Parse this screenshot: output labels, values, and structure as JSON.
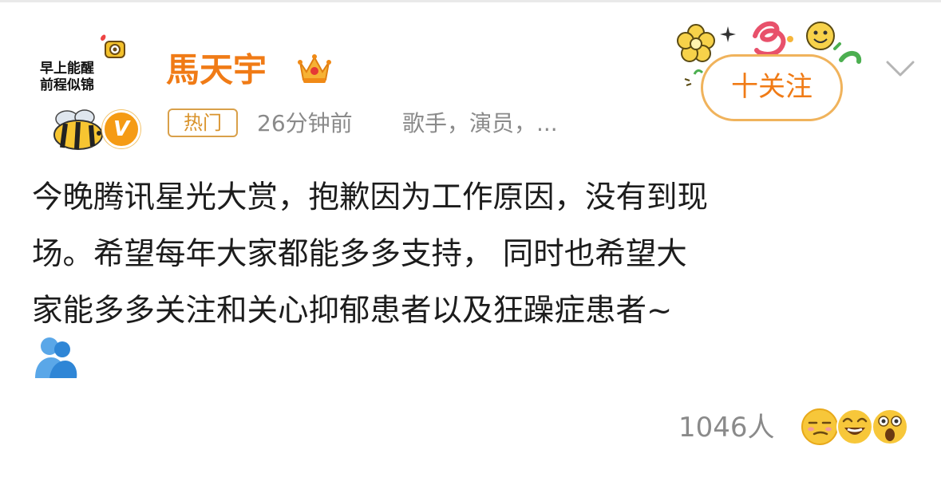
{
  "post": {
    "author": {
      "name": "馬天宇",
      "avatar_text": [
        "早上能醒",
        "前程似锦"
      ],
      "verified_badge": "V",
      "crown_icon": "crown-icon"
    },
    "meta": {
      "badge": "热门",
      "time": "26分钟前",
      "tags": "歌手，演员，..."
    },
    "follow_button": "十关注",
    "content_lines": [
      "今晚腾讯星光大赏，抱歉因为工作原因，没有到现",
      "场。希望每年大家都能多多支持， 同时也希望大",
      "家能多多关注和关心抑郁患者以及狂躁症患者~"
    ],
    "content_emoji": "hug-emoji-icon",
    "reactions": {
      "count": "1046人",
      "icons": [
        "smirk-emoji-icon",
        "laugh-emoji-icon",
        "shocked-emoji-icon"
      ]
    }
  },
  "colors": {
    "brand_orange": "#f07b16",
    "badge_border": "#d9a04a",
    "meta_gray": "#8a8a8a",
    "text": "#1c1c1c"
  }
}
